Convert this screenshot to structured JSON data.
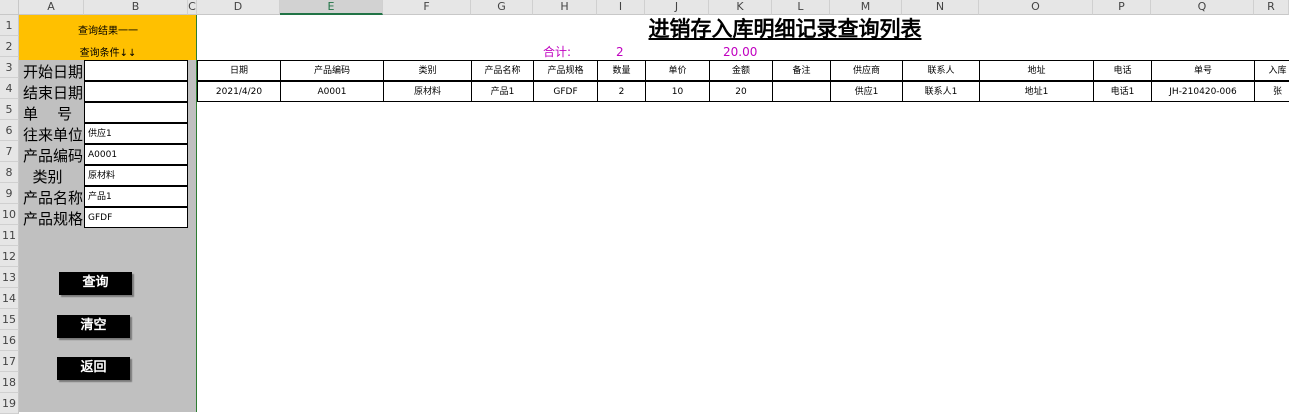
{
  "columns": [
    "A",
    "B",
    "C",
    "D",
    "E",
    "F",
    "G",
    "H",
    "I",
    "J",
    "K",
    "L",
    "M",
    "N",
    "O",
    "P",
    "Q",
    "R"
  ],
  "rows": [
    "1",
    "2",
    "3",
    "4",
    "5",
    "6",
    "7",
    "8",
    "9",
    "10",
    "11",
    "12",
    "13",
    "14",
    "15",
    "16",
    "17",
    "18",
    "19"
  ],
  "panel": {
    "result_label": "查询结果一一",
    "condition_label": "查询条件↓↓",
    "fields": [
      {
        "label": "开始日期",
        "value": ""
      },
      {
        "label": "结束日期",
        "value": ""
      },
      {
        "label": "单    号",
        "value": ""
      },
      {
        "label": "往来单位",
        "value": "供应1"
      },
      {
        "label": "产品编码",
        "value": "A0001"
      },
      {
        "label": "  类别",
        "value": "原材料"
      },
      {
        "label": "产品名称",
        "value": "产品1"
      },
      {
        "label": "产品规格",
        "value": "GFDF"
      }
    ],
    "buttons": {
      "query": "查询",
      "clear": "清空",
      "back": "返回"
    }
  },
  "title": "进销存入库明细记录查询列表",
  "summary": {
    "label": "合计:",
    "qty": "2",
    "amount": "20.00"
  },
  "table": {
    "headers": [
      "日期",
      "产品编码",
      "类别",
      "产品名称",
      "产品规格",
      "数量",
      "单价",
      "金额",
      "备注",
      "供应商",
      "联系人",
      "地址",
      "电话",
      "单号",
      "入库"
    ],
    "rows": [
      [
        "2021/4/20",
        "A0001",
        "原材料",
        "产品1",
        "GFDF",
        "2",
        "10",
        "20",
        "",
        "供应1",
        "联系人1",
        "地址1",
        "电话1",
        "JH-210420-006",
        "张"
      ]
    ]
  }
}
